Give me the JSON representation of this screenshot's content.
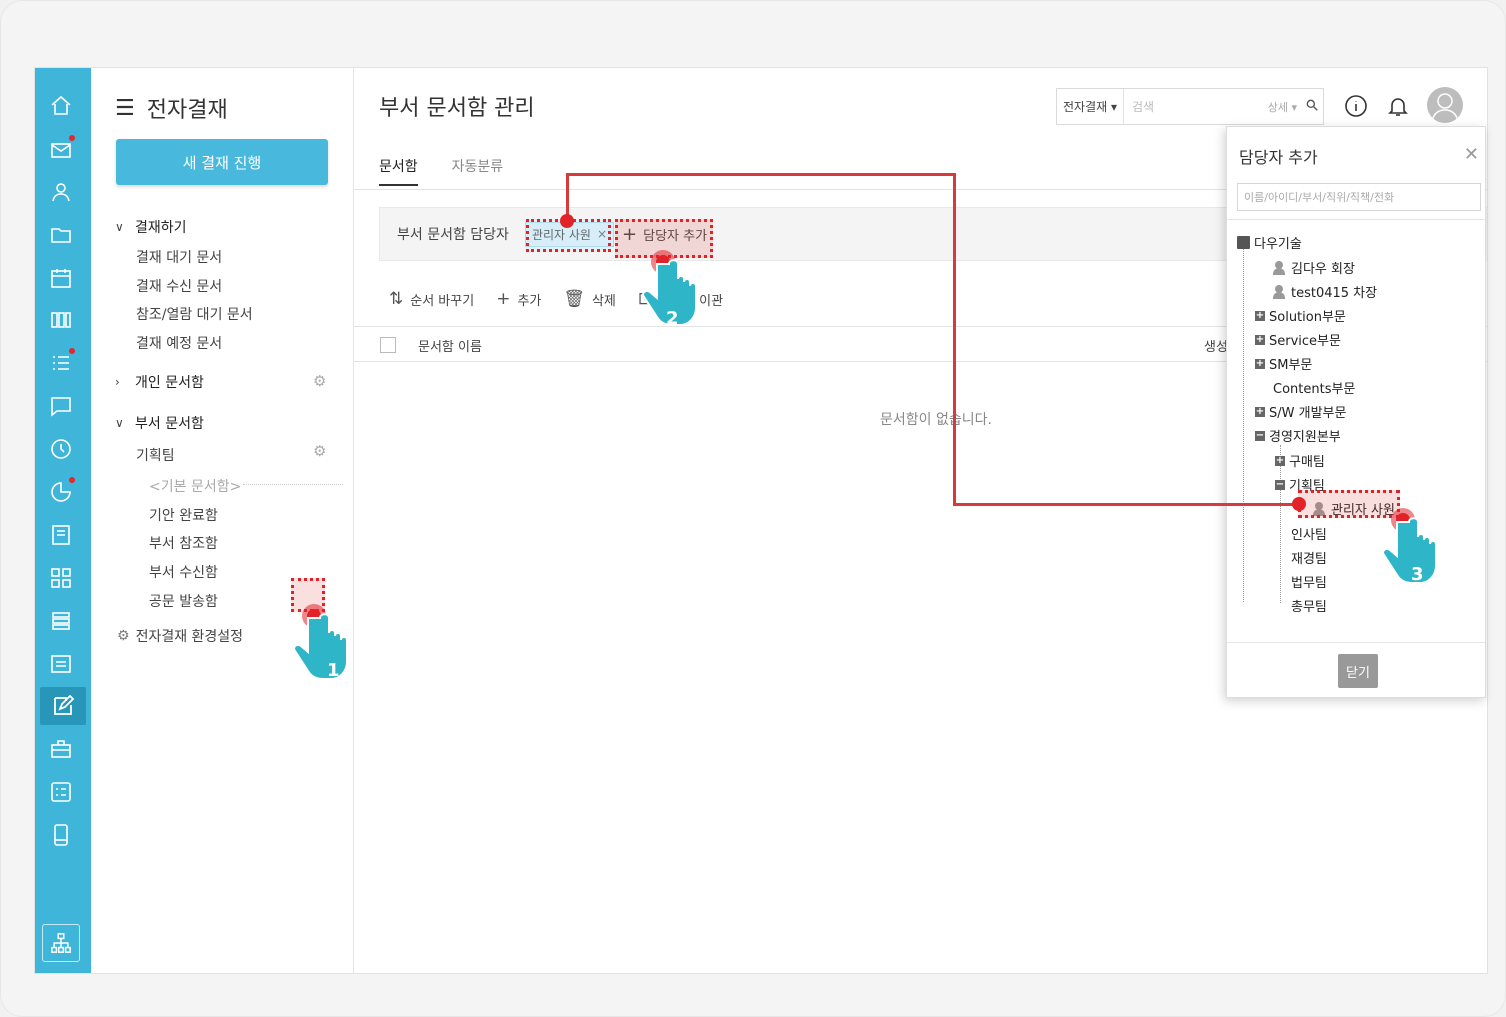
{
  "app": {
    "menu_title": "전자결재",
    "new_button": "새 결재 진행"
  },
  "menu": {
    "approve_section": "결재하기",
    "approve_items": [
      "결재 대기 문서",
      "결재 수신 문서",
      "참조/열람 대기 문서",
      "결재 예정 문서"
    ],
    "personal_section": "개인 문서함",
    "dept_section": "부서 문서함",
    "dept_team": "기획팀",
    "default_box": "<기본 문서함>",
    "team_items": [
      "기안 완료함",
      "부서 참조함",
      "부서 수신함",
      "공문 발송함"
    ],
    "settings": "전자결재 환경설정"
  },
  "header": {
    "page_title": "부서 문서함 관리",
    "search_scope": "전자결재 ▾",
    "search_placeholder": "검색",
    "search_detail": "상세 ▾"
  },
  "tabs": [
    "문서함",
    "자동분류"
  ],
  "owner_bar": {
    "label": "부서 문서함 담당자",
    "chip": "관리자 사원",
    "add": "담당자 추가"
  },
  "toolbar": {
    "reorder": "순서 바꾸기",
    "add": "추가",
    "delete": "삭제",
    "transfer": "문서함 이관"
  },
  "table": {
    "col_name": "문서함 이름",
    "col_created": "생성",
    "empty": "문서함이 없습니다."
  },
  "popup": {
    "title": "담당자 추가",
    "search_placeholder": "이름/아이디/부서/직위/직책/전화",
    "close": "닫기",
    "company": "다우기술",
    "people_root": [
      "김다우 회장",
      "test0415 차장"
    ],
    "depts": [
      "Solution부문",
      "Service부문",
      "SM부문",
      "Contents부문",
      "S/W 개발부문",
      "경영지원본부"
    ],
    "sub_depts": [
      "구매팀",
      "기획팀"
    ],
    "team_member": "관리자 사원",
    "other_teams": [
      "인사팀",
      "재경팀",
      "법무팀",
      "총무팀"
    ]
  },
  "steps": [
    "1",
    "2",
    "3"
  ],
  "colors": {
    "rail": "#3fb6d9",
    "accent": "#48b9dd",
    "annotation": "#e12229",
    "hand": "#2fb5c8"
  }
}
